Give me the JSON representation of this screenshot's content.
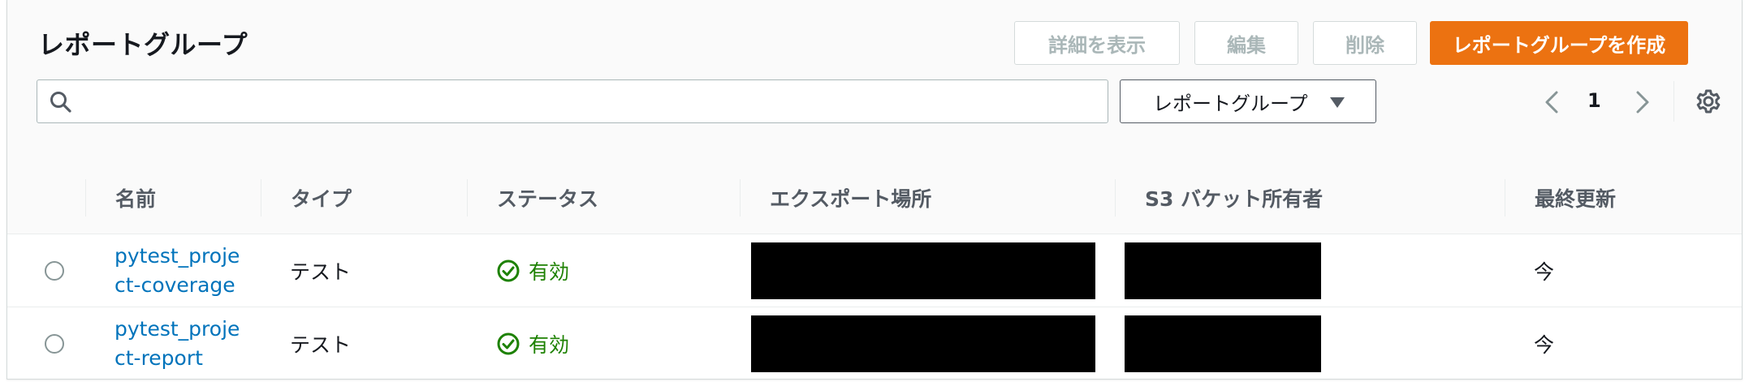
{
  "header": {
    "title": "レポートグループ",
    "buttons": {
      "details": "詳細を表示",
      "edit": "編集",
      "delete": "削除",
      "create": "レポートグループを作成"
    }
  },
  "filter": {
    "search_value": "",
    "search_placeholder": "",
    "select_value": "レポートグループ"
  },
  "pagination": {
    "current_page": "1"
  },
  "table": {
    "columns": [
      "名前",
      "タイプ",
      "ステータス",
      "エクスポート場所",
      "S3 バケット所有者",
      "最終更新"
    ],
    "rows": [
      {
        "name": "pytest_project-coverage",
        "type": "テスト",
        "status": "有効",
        "export_location": "",
        "bucket_owner": "",
        "last_updated": "今"
      },
      {
        "name": "pytest_project-report",
        "type": "テスト",
        "status": "有効",
        "export_location": "",
        "bucket_owner": "",
        "last_updated": "今"
      }
    ]
  },
  "colors": {
    "primary": "#ec7211",
    "link": "#0073bb",
    "success": "#1d8102",
    "disabled_text": "#aab7b8"
  },
  "icons": {
    "search": "search-icon",
    "status": "check-circle-icon",
    "prev": "chevron-left-icon",
    "next": "chevron-right-icon",
    "settings": "gear-icon",
    "dropdown": "caret-down-icon"
  }
}
